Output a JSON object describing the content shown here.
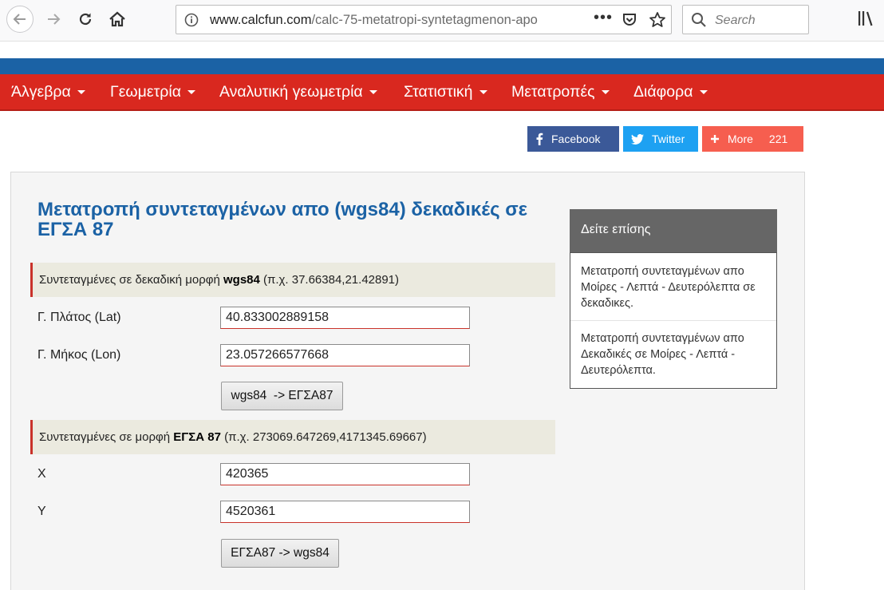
{
  "browser": {
    "url_domain": "www.calcfun.com",
    "url_path": "/calc-75-metatropi-syntetagmenon-apo",
    "url_more": "•••",
    "search_placeholder": "Search"
  },
  "nav_menu": {
    "items": [
      {
        "label": "Άλγεβρα"
      },
      {
        "label": "Γεωμετρία"
      },
      {
        "label": "Αναλυτική γεωμετρία"
      },
      {
        "label": "Στατιστική"
      },
      {
        "label": "Μετατροπές"
      },
      {
        "label": "Διάφορα"
      }
    ]
  },
  "share": {
    "facebook": "Facebook",
    "twitter": "Twitter",
    "more": "More",
    "count": "221"
  },
  "main": {
    "title": "Μετατροπή συντεταγμένων απο (wgs84) δεκαδικές σε ΕΓΣΑ 87",
    "section1": {
      "prefix": "Συντεταγμένες σε δεκαδική μορφή ",
      "bold": "wgs84",
      "suffix": " (π.χ. 37.66384,21.42891)",
      "lat_label": "Γ. Πλάτος (Lat)",
      "lat_value": "40.833002889158",
      "lon_label": "Γ. Μήκος (Lon)",
      "lon_value": "23.057266577668",
      "button": "wgs84  -> ΕΓΣΑ87"
    },
    "section2": {
      "prefix": "Συντεταγμένες σε μορφή ",
      "bold": "ΕΓΣΑ 87",
      "suffix": " (π.χ. 273069.647269,4171345.69667)",
      "x_label": "X",
      "x_value": "420365",
      "y_label": "Y",
      "y_value": "4520361",
      "button": "ΕΓΣΑ87 -> wgs84"
    }
  },
  "sidebar": {
    "heading": "Δείτε επίσης",
    "links": [
      {
        "text": "Μετατροπή συντεταγμένων απο Μοίρες - Λεπτά - Δευτερόλεπτα σε δεκαδικες."
      },
      {
        "text": "Μετατροπή συντεταγμένων απο Δεκαδικές σε Μοίρες - Λεπτά - Δευτερόλεπτα."
      }
    ]
  },
  "colors": {
    "nav_red": "#d9281f",
    "header_blue": "#1b62a5",
    "facebook": "#3b5998",
    "twitter": "#1da1f2",
    "more": "#f65e4f"
  },
  "icons": [
    "back-arrow-icon",
    "forward-arrow-icon",
    "reload-icon",
    "home-icon",
    "info-icon",
    "pocket-icon",
    "star-icon",
    "search-icon",
    "library-icon",
    "facebook-icon",
    "twitter-icon",
    "plus-icon"
  ]
}
